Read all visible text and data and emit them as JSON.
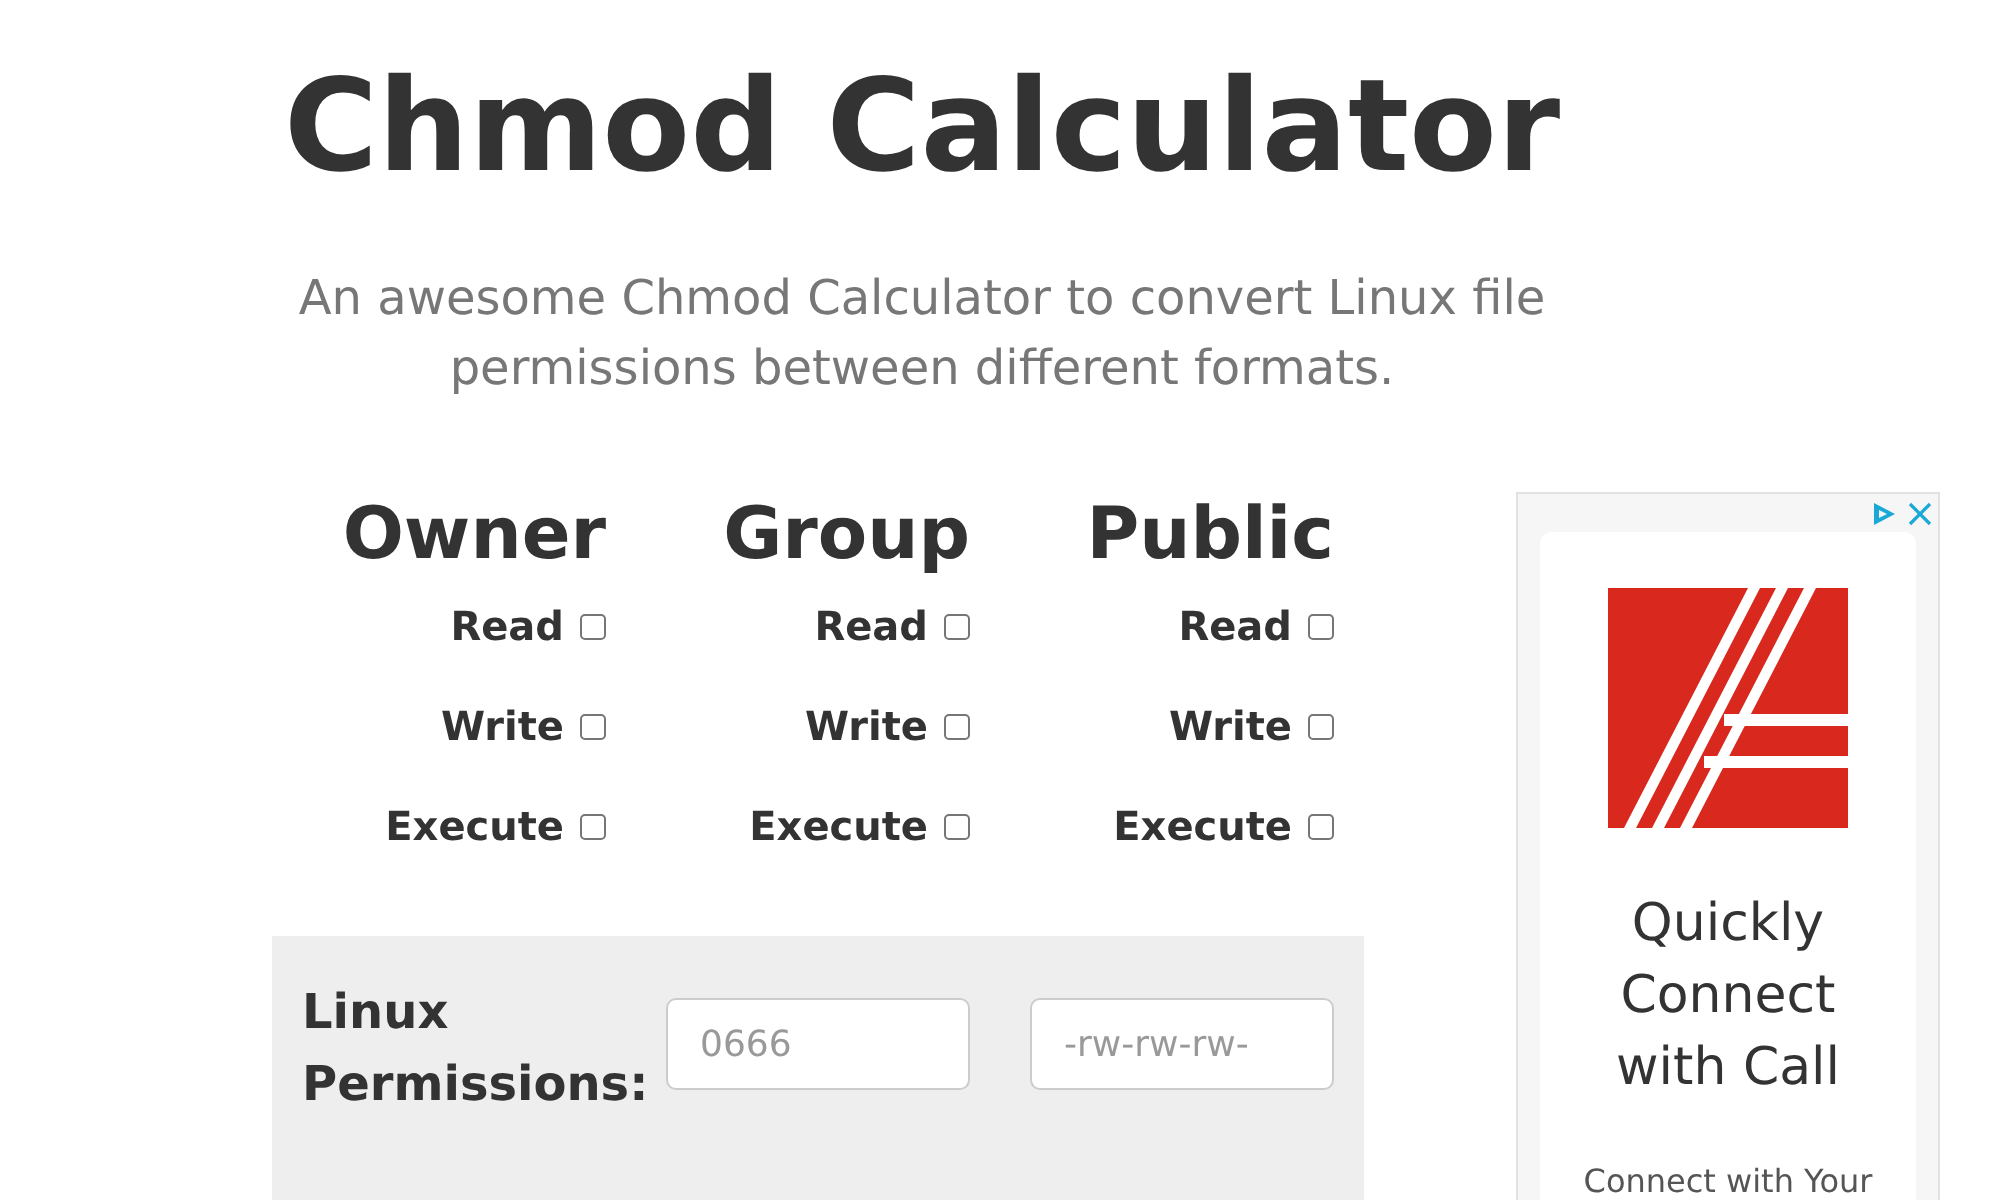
{
  "title": "Chmod Calculator",
  "subtitle": "An awesome Chmod Calculator to convert Linux file permissions between different formats.",
  "groups": [
    {
      "name": "Owner",
      "permissions": [
        {
          "label": "Read",
          "checked": false
        },
        {
          "label": "Write",
          "checked": false
        },
        {
          "label": "Execute",
          "checked": false
        }
      ]
    },
    {
      "name": "Group",
      "permissions": [
        {
          "label": "Read",
          "checked": false
        },
        {
          "label": "Write",
          "checked": false
        },
        {
          "label": "Execute",
          "checked": false
        }
      ]
    },
    {
      "name": "Public",
      "permissions": [
        {
          "label": "Read",
          "checked": false
        },
        {
          "label": "Write",
          "checked": false
        },
        {
          "label": "Execute",
          "checked": false
        }
      ]
    }
  ],
  "linux_permissions": {
    "label": "Linux Permissions:",
    "fields": [
      {
        "placeholder": "0666"
      },
      {
        "placeholder": "-rw-rw-rw-"
      }
    ]
  },
  "ad": {
    "heading": "Quickly Connect with Call",
    "body": "Connect with Your"
  }
}
